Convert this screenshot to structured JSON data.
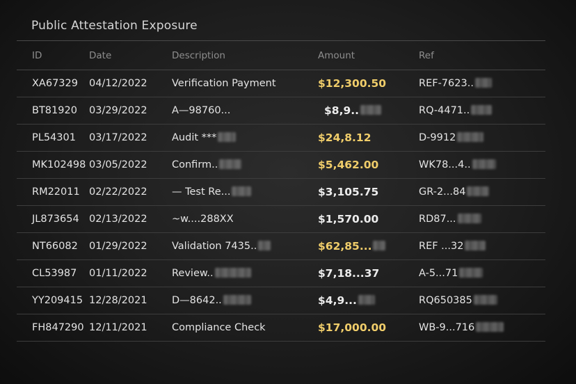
{
  "title": "Public Attestation Exposure",
  "columns": {
    "id": "ID",
    "date": "Date",
    "description": "Description",
    "amount": "Amount",
    "ref": "Ref"
  },
  "rows": [
    {
      "id": "XA67329",
      "date": "04/12/2022",
      "description": "Verification Payment",
      "amount": "$12,300.50",
      "ref": "REF-7623.."
    },
    {
      "id": "BT81920",
      "date": "03/29/2022",
      "description": "A—98760...",
      "amount": "$8,9..",
      "ref": "RQ-4471.."
    },
    {
      "id": "PL54301",
      "date": "03/17/2022",
      "description": "Audit ***",
      "amount": "$24,8.12",
      "ref": "D-9912"
    },
    {
      "id": "MK102498",
      "date": "03/05/2022",
      "description": "Confirm..",
      "amount": "$5,462.00",
      "ref": "WK78...4.."
    },
    {
      "id": "RM22011",
      "date": "02/22/2022",
      "description": "— Test Re...",
      "amount": "$3,105.75",
      "ref": "GR-2...84"
    },
    {
      "id": "JL873654",
      "date": "02/13/2022",
      "description": "~w....288XX",
      "amount": "$1,570.00",
      "ref": "RD87..."
    },
    {
      "id": "NT66082",
      "date": "01/29/2022",
      "description": "Validation 7435..",
      "amount": "$62,85...",
      "ref": "REF ...32"
    },
    {
      "id": "CL53987",
      "date": "01/11/2022",
      "description": "Review..",
      "amount": "$7,18...37",
      "ref": "A-5...71"
    },
    {
      "id": "YY209415",
      "date": "12/28/2021",
      "description": "D—8642..",
      "amount": "$4,9...",
      "ref": "RQ650385"
    },
    {
      "id": "FH847290",
      "date": "12/11/2021",
      "description": "Compliance Check",
      "amount": "$17,000.00",
      "ref": "WB-9...716"
    }
  ],
  "colors": {
    "amount_highlight": "#f0cd6a",
    "amount_normal": "#ececec",
    "background": "#1d1d1d"
  }
}
